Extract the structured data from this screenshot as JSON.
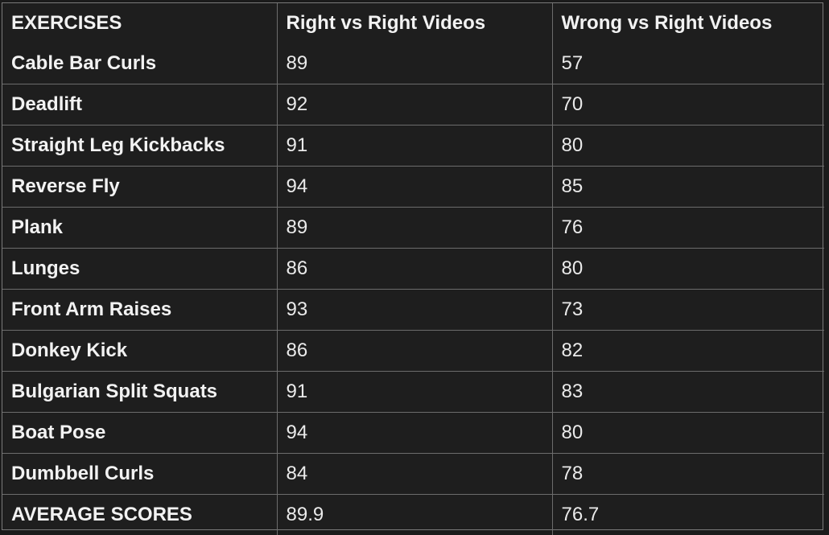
{
  "table": {
    "headers": [
      "EXERCISES",
      "Right vs Right Videos",
      "Wrong vs Right Videos"
    ],
    "rows": [
      [
        "Cable Bar Curls",
        "89",
        "57"
      ],
      [
        "Deadlift",
        "92",
        "70"
      ],
      [
        "Straight Leg Kickbacks",
        "91",
        "80"
      ],
      [
        "Reverse Fly",
        "94",
        "85"
      ],
      [
        "Plank",
        "89",
        "76"
      ],
      [
        "Lunges",
        "86",
        "80"
      ],
      [
        "Front Arm Raises",
        "93",
        "73"
      ],
      [
        "Donkey Kick",
        "86",
        "82"
      ],
      [
        "Bulgarian Split Squats",
        "91",
        "83"
      ],
      [
        "Boat Pose",
        "94",
        "80"
      ],
      [
        "Dumbbell Curls",
        "84",
        "78"
      ]
    ],
    "footer": [
      "AVERAGE SCORES",
      "89.9",
      "76.7"
    ]
  },
  "colors": {
    "background": "#1e1e1e",
    "text": "#f2f2f2",
    "grid": "#6c6c6c"
  }
}
